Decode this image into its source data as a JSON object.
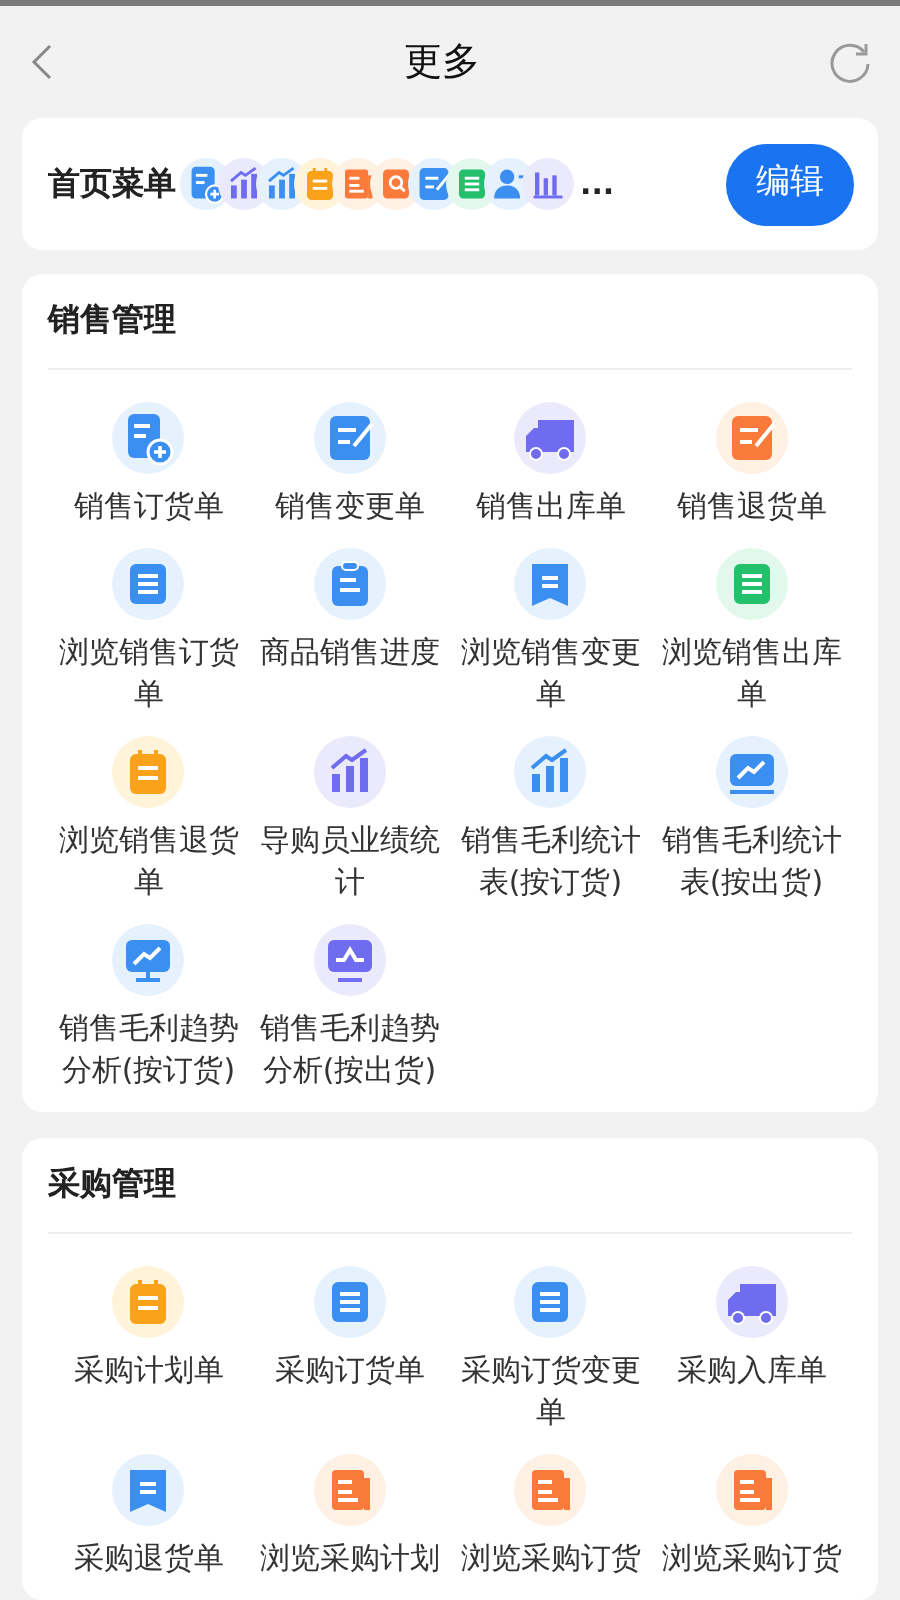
{
  "header": {
    "title": "更多"
  },
  "home_menu": {
    "label": "首页菜单",
    "icons": [
      {
        "kind": "doc-add"
      },
      {
        "kind": "chart-up"
      },
      {
        "kind": "bar-chart"
      },
      {
        "kind": "notepad"
      },
      {
        "kind": "doc-copy"
      },
      {
        "kind": "doc-search"
      },
      {
        "kind": "doc-edit"
      },
      {
        "kind": "sheet"
      },
      {
        "kind": "user"
      },
      {
        "kind": "bars"
      }
    ],
    "more": "...",
    "edit_button": "编辑"
  },
  "sections": [
    {
      "title": "销售管理",
      "items": [
        {
          "label": "销售订货单",
          "kind": "doc-add"
        },
        {
          "label": "销售变更单",
          "kind": "doc-edit"
        },
        {
          "label": "销售出库单",
          "kind": "truck"
        },
        {
          "label": "销售退货单",
          "kind": "doc-pen"
        },
        {
          "label": "浏览销售订货单",
          "kind": "list"
        },
        {
          "label": "商品销售进度",
          "kind": "clipboard"
        },
        {
          "label": "浏览销售变更单",
          "kind": "bookmark"
        },
        {
          "label": "浏览销售出库单",
          "kind": "sheet"
        },
        {
          "label": "浏览销售退货单",
          "kind": "notepad"
        },
        {
          "label": "导购员业绩统计",
          "kind": "chart-up"
        },
        {
          "label": "销售毛利统计表(按订货)",
          "kind": "bar-chart"
        },
        {
          "label": "销售毛利统计表(按出货)",
          "kind": "screen-up"
        },
        {
          "label": "销售毛利趋势分析(按订货)",
          "kind": "monitor-up"
        },
        {
          "label": "销售毛利趋势分析(按出货)",
          "kind": "monitor-wave"
        }
      ]
    },
    {
      "title": "采购管理",
      "items": [
        {
          "label": "采购计划单",
          "kind": "notepad"
        },
        {
          "label": "采购订货单",
          "kind": "list"
        },
        {
          "label": "采购订货变更单",
          "kind": "list"
        },
        {
          "label": "采购入库单",
          "kind": "truck"
        },
        {
          "label": "采购退货单",
          "kind": "bookmark"
        },
        {
          "label": "浏览采购计划",
          "kind": "doc-copy"
        },
        {
          "label": "浏览采购订货",
          "kind": "doc-copy"
        },
        {
          "label": "浏览采购订货",
          "kind": "doc-copy"
        }
      ]
    }
  ]
}
